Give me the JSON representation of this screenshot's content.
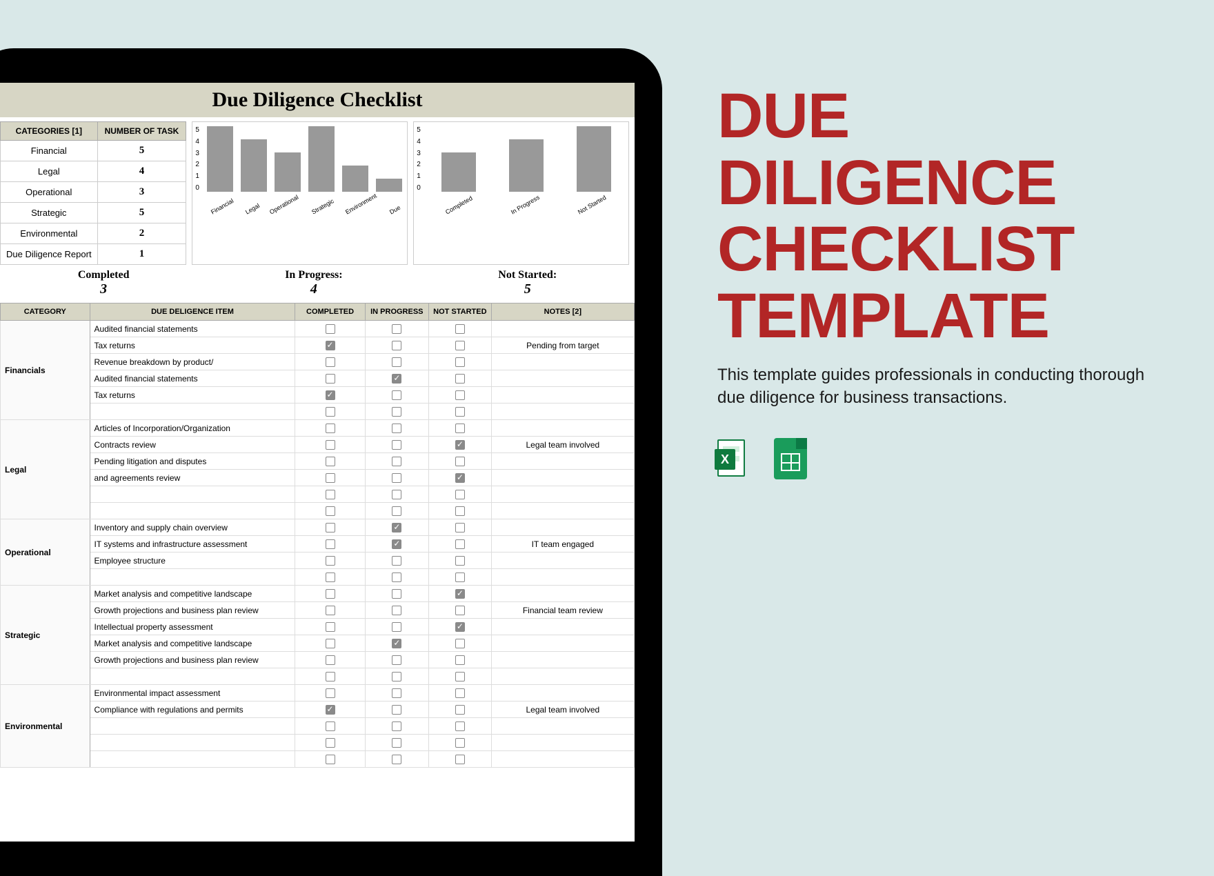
{
  "title_bar": "Due Diligence Checklist",
  "cat_headers": {
    "c1": "CATEGORIES [1]",
    "c2": "NUMBER OF TASK"
  },
  "categories": [
    {
      "name": "Financial",
      "count": "5"
    },
    {
      "name": "Legal",
      "count": "4"
    },
    {
      "name": "Operational",
      "count": "3"
    },
    {
      "name": "Strategic",
      "count": "5"
    },
    {
      "name": "Environmental",
      "count": "2"
    },
    {
      "name": "Due Diligence Report",
      "count": "1"
    }
  ],
  "chart_data": [
    {
      "type": "bar",
      "categories": [
        "Financial",
        "Legal",
        "Operational",
        "Strategic",
        "Environment",
        "Due"
      ],
      "values": [
        5,
        4,
        3,
        5,
        2,
        1
      ],
      "ylim": [
        0,
        5
      ]
    },
    {
      "type": "bar",
      "categories": [
        "Completed",
        "In Progress",
        "Not Started"
      ],
      "values": [
        3,
        4,
        5
      ],
      "ylim": [
        0,
        5
      ]
    }
  ],
  "summary": {
    "completed": {
      "label": "Completed",
      "value": "3"
    },
    "inprogress": {
      "label": "In Progress:",
      "value": "4"
    },
    "notstarted": {
      "label": "Not Started:",
      "value": "5"
    }
  },
  "main_headers": {
    "category": "CATEGORY",
    "item": "DUE DELIGENCE ITEM",
    "completed": "COMPLETED",
    "inprogress": "IN PROGRESS",
    "notstarted": "NOT STARTED",
    "notes": "NOTES [2]"
  },
  "sections": [
    {
      "category": "Financials",
      "rows": [
        {
          "item": "Audited financial statements",
          "c": 0,
          "p": 0,
          "n": 0,
          "notes": ""
        },
        {
          "item": "Tax returns",
          "c": 1,
          "p": 0,
          "n": 0,
          "notes": "Pending from target"
        },
        {
          "item": "Revenue breakdown by product/",
          "c": 0,
          "p": 0,
          "n": 0,
          "notes": ""
        },
        {
          "item": "Audited financial statements",
          "c": 0,
          "p": 1,
          "n": 0,
          "notes": ""
        },
        {
          "item": "Tax returns",
          "c": 1,
          "p": 0,
          "n": 0,
          "notes": ""
        },
        {
          "item": "",
          "c": 0,
          "p": 0,
          "n": 0,
          "notes": ""
        }
      ]
    },
    {
      "category": "Legal",
      "rows": [
        {
          "item": "Articles of Incorporation/Organization",
          "c": 0,
          "p": 0,
          "n": 0,
          "notes": ""
        },
        {
          "item": "Contracts review",
          "c": 0,
          "p": 0,
          "n": 1,
          "notes": "Legal team involved"
        },
        {
          "item": "Pending litigation and disputes",
          "c": 0,
          "p": 0,
          "n": 0,
          "notes": ""
        },
        {
          "item": "and agreements review",
          "c": 0,
          "p": 0,
          "n": 1,
          "notes": ""
        },
        {
          "item": "",
          "c": 0,
          "p": 0,
          "n": 0,
          "notes": ""
        },
        {
          "item": "",
          "c": 0,
          "p": 0,
          "n": 0,
          "notes": ""
        }
      ]
    },
    {
      "category": "Operational",
      "rows": [
        {
          "item": "Inventory and supply chain overview",
          "c": 0,
          "p": 1,
          "n": 0,
          "notes": ""
        },
        {
          "item": "IT systems and infrastructure assessment",
          "c": 0,
          "p": 1,
          "n": 0,
          "notes": "IT team engaged"
        },
        {
          "item": "Employee structure",
          "c": 0,
          "p": 0,
          "n": 0,
          "notes": ""
        },
        {
          "item": "",
          "c": 0,
          "p": 0,
          "n": 0,
          "notes": ""
        }
      ]
    },
    {
      "category": "Strategic",
      "rows": [
        {
          "item": "Market analysis and competitive landscape",
          "c": 0,
          "p": 0,
          "n": 1,
          "notes": ""
        },
        {
          "item": "Growth projections and business plan review",
          "c": 0,
          "p": 0,
          "n": 0,
          "notes": "Financial team review"
        },
        {
          "item": "Intellectual property assessment",
          "c": 0,
          "p": 0,
          "n": 1,
          "notes": ""
        },
        {
          "item": "Market analysis and competitive landscape",
          "c": 0,
          "p": 1,
          "n": 0,
          "notes": ""
        },
        {
          "item": "Growth projections and business plan review",
          "c": 0,
          "p": 0,
          "n": 0,
          "notes": ""
        },
        {
          "item": "",
          "c": 0,
          "p": 0,
          "n": 0,
          "notes": ""
        }
      ]
    },
    {
      "category": "Environmental",
      "rows": [
        {
          "item": "Environmental impact assessment",
          "c": 0,
          "p": 0,
          "n": 0,
          "notes": ""
        },
        {
          "item": "Compliance with regulations and permits",
          "c": 1,
          "p": 0,
          "n": 0,
          "notes": "Legal team involved"
        },
        {
          "item": "",
          "c": 0,
          "p": 0,
          "n": 0,
          "notes": ""
        },
        {
          "item": "",
          "c": 0,
          "p": 0,
          "n": 0,
          "notes": ""
        },
        {
          "item": "",
          "c": 0,
          "p": 0,
          "n": 0,
          "notes": ""
        }
      ]
    }
  ],
  "promo": {
    "headline_l1": "DUE",
    "headline_l2": "DILIGENCE",
    "headline_l3": "CHECKLIST",
    "headline_l4": "TEMPLATE",
    "desc": "This template guides professionals in conducting thorough due diligence for business transactions.",
    "excel_letter": "X"
  }
}
